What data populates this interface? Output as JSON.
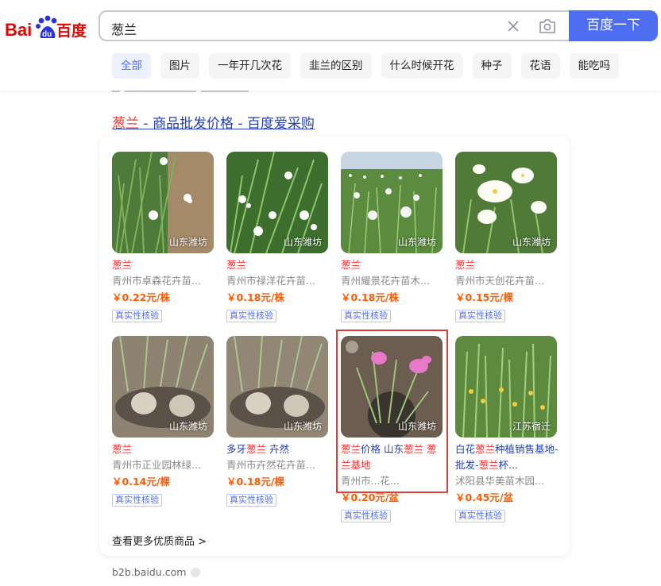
{
  "logo": {
    "text_left": "Bai",
    "text_paw": "du",
    "text_right": "百度"
  },
  "search": {
    "query": "葱兰",
    "button_label": "百度一下"
  },
  "tabs": [
    "全部",
    "图片",
    "一年开几次花",
    "韭兰的区别",
    "什么时候开花",
    "种子",
    "花语",
    "能吃吗"
  ],
  "result": {
    "title_hl": "葱兰",
    "title_rest": " - 商品批发价格 - 百度爱采购"
  },
  "products": [
    {
      "location": "山东潍坊",
      "name": "葱兰",
      "shop": "青州市卓森花卉苗...",
      "price": "￥0.22元/株",
      "verify": "真实性核验"
    },
    {
      "location": "山东潍坊",
      "name": "葱兰",
      "shop": "青州市禄洋花卉苗...",
      "price": "￥0.18元/株",
      "verify": "真实性核验"
    },
    {
      "location": "山东潍坊",
      "name": "葱兰",
      "shop": "青州耀景花卉苗木...",
      "price": "￥0.18元/株",
      "verify": "真实性核验"
    },
    {
      "location": "山东潍坊",
      "name": "葱兰",
      "shop": "青州市天创花卉苗...",
      "price": "￥0.15元/棵",
      "verify": "真实性核验"
    },
    {
      "location": "山东潍坊",
      "name": "葱兰",
      "shop": "青州市正业园林绿...",
      "price": "￥0.14元/棵",
      "verify": "真实性核验"
    },
    {
      "location": "山东潍坊",
      "name_pre": "多牙",
      "name_hl": "葱兰",
      "name_post": " 卉然",
      "shop": "青州市卉然花卉苗...",
      "price": "￥0.18元/棵",
      "verify": "真实性核验"
    },
    {
      "location": "山东潍坊",
      "name_line": "葱兰价格 山东葱兰 葱兰基地",
      "name_parts": [
        "葱兰",
        "价格 山东",
        "葱兰",
        " ",
        "葱",
        "兰基地"
      ],
      "shop": "青州市...花...",
      "price": "￥0.20元/盆",
      "verify": "真实性核验"
    },
    {
      "location": "江苏宿迁",
      "name_parts": [
        "白花",
        "葱兰",
        "种植销售基地-批发-",
        "葱兰",
        "杯..."
      ],
      "shop": "沭阳县华美苗木园...",
      "price": "￥0.45元/盆",
      "verify": "真实性核验"
    }
  ],
  "more_link": "查看更多优质商品 >",
  "source": "b2b.baidu.com",
  "colors": {
    "brand_blue": "#4e6ef2",
    "link_blue": "#2440b3",
    "red": "#f73131",
    "price_orange": "#fe5a00"
  }
}
